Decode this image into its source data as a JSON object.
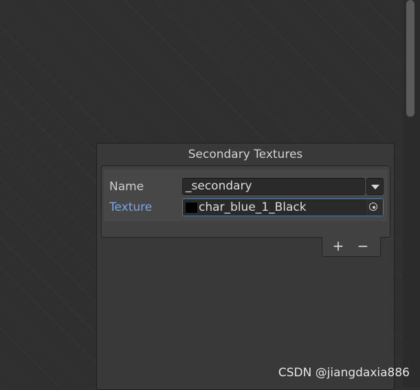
{
  "panel": {
    "title": "Secondary Textures"
  },
  "fields": {
    "name_label": "Name",
    "name_value": "_secondary",
    "texture_label": "Texture",
    "texture_value": "char_blue_1_Black"
  },
  "icons": {
    "dropdown": "chevron-down-icon",
    "picker": "object-picker-icon",
    "swatch": "texture-swatch"
  },
  "footer": {
    "add_label": "+",
    "remove_label": "−"
  },
  "watermark": {
    "text": "CSDN @jiangdaxia886"
  },
  "colors": {
    "accent": "#7aa6e6",
    "focus_border": "#3b7ed1",
    "swatch": "#000000"
  }
}
